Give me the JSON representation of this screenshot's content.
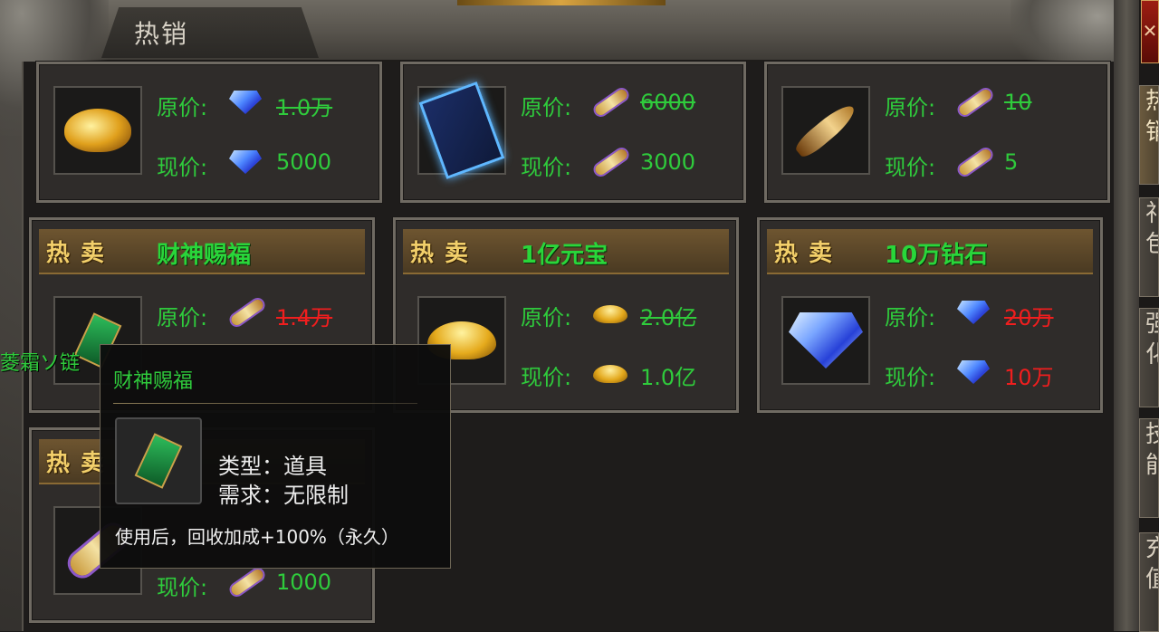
{
  "window": {
    "title": "热销",
    "close_glyph": "✕"
  },
  "side_tabs": [
    {
      "label": "热销",
      "active": true
    },
    {
      "label": "礼包",
      "active": false
    },
    {
      "label": "强化",
      "active": false
    },
    {
      "label": "技能",
      "active": false
    },
    {
      "label": "充值",
      "active": false
    }
  ],
  "price_labels": {
    "original": "原价:",
    "current": "现价:"
  },
  "hot_label": "热卖",
  "items": [
    {
      "name": "",
      "hot": false,
      "icon": "lamp",
      "currency": "diamond",
      "original": "1.0万",
      "current": "5000",
      "original_color": "green",
      "current_color": "green"
    },
    {
      "name": "",
      "hot": false,
      "icon": "skill-book",
      "currency": "scroll",
      "original": "6000",
      "current": "3000",
      "original_color": "green",
      "current_color": "green"
    },
    {
      "name": "",
      "hot": false,
      "icon": "horn",
      "currency": "scroll",
      "original": "10",
      "current": "5",
      "original_color": "green",
      "current_color": "green"
    },
    {
      "name": "财神赐福",
      "hot": true,
      "icon": "talisman",
      "currency": "scroll",
      "original": "1.4万",
      "current": "",
      "original_color": "red",
      "current_color": "red"
    },
    {
      "name": "1亿元宝",
      "hot": true,
      "icon": "gold-ingot",
      "currency": "ingot",
      "original": "2.0亿",
      "current": "1.0亿",
      "original_color": "green",
      "current_color": "green"
    },
    {
      "name": "10万钻石",
      "hot": true,
      "icon": "gem",
      "currency": "diamond",
      "original": "20万",
      "current": "10万",
      "original_color": "red",
      "current_color": "red"
    },
    {
      "name": "",
      "hot": true,
      "icon": "scroll",
      "currency": "scroll",
      "original": "",
      "current": "1000",
      "original_color": "green",
      "current_color": "green"
    }
  ],
  "player_name": "菱霜ソ链",
  "tooltip": {
    "name": "财神赐福",
    "type_line": "类型：道具",
    "req_line": "需求：无限制",
    "effect": "使用后，回收加成+100%（永久）"
  },
  "colors": {
    "price_green": "#2fcb3c",
    "price_red": "#f01e1e",
    "hot_gold": "#f2cf6a"
  }
}
